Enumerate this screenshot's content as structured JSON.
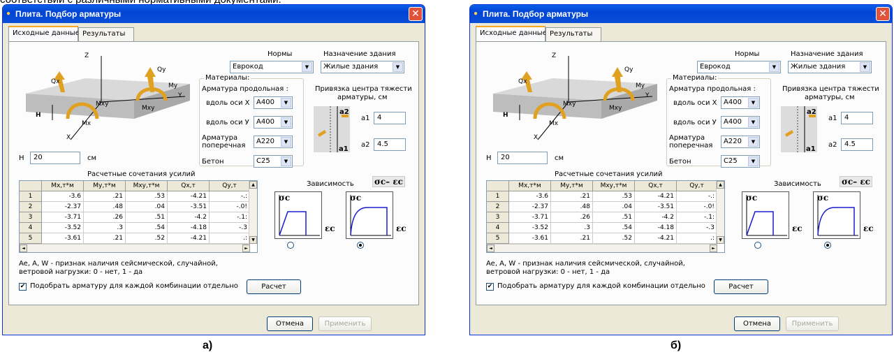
{
  "doc": {
    "top_text": "соответствии с различными нормативными документами."
  },
  "captions": {
    "left": "а)",
    "right": "б)"
  },
  "colors": {
    "titlebar": "#0a5ee8",
    "panel": "#ece9d8",
    "curve": "#1a1ad0",
    "arrows": "#e0a020"
  },
  "windows": [
    {
      "title": "Плита. Подбор арматуры",
      "tabs": [
        "Исходные данные",
        "Результаты"
      ],
      "norms": {
        "label": "Нормы",
        "value": "Еврокод"
      },
      "purpose": {
        "label": "Назначение здания",
        "value": "Жилые здания"
      },
      "materials": {
        "group_label": "Материалы:",
        "long_rebar_label": "Арматура  продольная :",
        "along_x_label": "вдоль оси X",
        "along_x_value": "A400",
        "along_y_label": "вдоль оси У",
        "along_y_value": "A400",
        "transverse_label_1": "Арматура",
        "transverse_label_2": "поперечная",
        "transverse_value": "A220",
        "concrete_label": "Бетон",
        "concrete_value": "C25"
      },
      "binding": {
        "title_1": "Привязка центра тяжести",
        "title_2": "арматуры, см",
        "a1_label": "a1",
        "a1_value": "4",
        "a2_label": "a2",
        "a2_value": "4.5",
        "pic_a2": "a2",
        "pic_a1": "a1"
      },
      "slab_labels": {
        "z": "Z",
        "y": "Y",
        "x": "X",
        "qx": "Qx",
        "qy": "Qy",
        "my": "My",
        "mxy_a": "Mxy",
        "mxy_b": "Mxy",
        "mx": "Mx",
        "h": "H"
      },
      "h_field": {
        "label": "H",
        "value": "20",
        "unit": "см"
      },
      "grid": {
        "title": "Расчетные сочетания усилий",
        "columns": [
          "Mx,т*м",
          "My,т*м",
          "Mxy,т*м",
          "Qx,т",
          "Qy,т"
        ],
        "rows": [
          {
            "n": "1",
            "cells": [
              "-3.6",
              ".21",
              ".53",
              "-4.21",
              "-.:"
            ]
          },
          {
            "n": "2",
            "cells": [
              "-2.37",
              ".48",
              ".04",
              "-3.51",
              "-.0!"
            ]
          },
          {
            "n": "3",
            "cells": [
              "-3.71",
              ".26",
              ".51",
              "-4.2",
              "-.1:"
            ]
          },
          {
            "n": "4",
            "cells": [
              "-3.52",
              ".3",
              ".54",
              "-4.18",
              "-.3"
            ]
          },
          {
            "n": "5",
            "cells": [
              "-3.61",
              ".21",
              ".52",
              "-4.21",
              ".:"
            ]
          }
        ]
      },
      "dependency": {
        "label": "Зависимость",
        "formula": "σc– εc",
        "sigma": "σc",
        "eps": "εc"
      },
      "note_1": "Ae, A, W  -  признак наличия сейсмической, случайной,",
      "note_2": "ветровой нагрузки: 0 - нет, 1 - да",
      "checkbox_label": "Подобрать арматуру для каждой комбинации отдельно",
      "calc_button": "Расчет",
      "cancel_button": "Отмена",
      "apply_button": "Применить"
    },
    {
      "title": "Плита. Подбор арматуры",
      "tabs": [
        "Исходные данные",
        "Результаты"
      ],
      "norms": {
        "label": "Нормы",
        "value": "Еврокод"
      },
      "purpose": {
        "label": "Назначение здания",
        "value": "Жилые здания"
      },
      "materials": {
        "group_label": "Материалы:",
        "long_rebar_label": "Арматура  продольная :",
        "along_x_label": "вдоль оси X",
        "along_x_value": "A400",
        "along_y_label": "вдоль оси У",
        "along_y_value": "A400",
        "transverse_label_1": "Арматура",
        "transverse_label_2": "поперечная",
        "transverse_value": "A220",
        "concrete_label": "Бетон",
        "concrete_value": "C25"
      },
      "binding": {
        "title_1": "Привязка центра тяжести",
        "title_2": "арматуры, см",
        "a1_label": "a1",
        "a1_value": "4",
        "a2_label": "a2",
        "a2_value": "4.5",
        "pic_a2": "a2",
        "pic_a1": "a1"
      },
      "slab_labels": {
        "z": "Z",
        "y": "Y",
        "x": "X",
        "qx": "Qx",
        "qy": "Qy",
        "my": "My",
        "mxy_a": "Mxy",
        "mxy_b": "Mxy",
        "mx": "Mx",
        "h": "H"
      },
      "h_field": {
        "label": "H",
        "value": "20",
        "unit": "см"
      },
      "grid": {
        "title": "Расчетные сочетания усилий",
        "columns": [
          "Mx,т*м",
          "My,т*м",
          "Mxy,т*м",
          "Qx,т",
          "Qy,т"
        ],
        "rows": [
          {
            "n": "1",
            "cells": [
              "-3.6",
              ".21",
              ".53",
              "-4.21",
              "-.:"
            ]
          },
          {
            "n": "2",
            "cells": [
              "-2.37",
              ".48",
              ".04",
              "-3.51",
              "-.0!"
            ]
          },
          {
            "n": "3",
            "cells": [
              "-3.71",
              ".26",
              ".51",
              "-4.2",
              "-.1:"
            ]
          },
          {
            "n": "4",
            "cells": [
              "-3.52",
              ".3",
              ".54",
              "-4.18",
              "-.3"
            ]
          },
          {
            "n": "5",
            "cells": [
              "-3.61",
              ".21",
              ".52",
              "-4.21",
              ".:"
            ]
          }
        ]
      },
      "dependency": {
        "label": "Зависимость",
        "formula": "σc– εc",
        "sigma": "σc",
        "eps": "εc"
      },
      "note_1": "Ae, A, W  -  признак наличия сейсмической, случайной,",
      "note_2": "ветровой нагрузки: 0 - нет, 1 - да",
      "checkbox_label": "Подобрать арматуру для каждой комбинации отдельно",
      "calc_button": "Расчет",
      "cancel_button": "Отмена",
      "apply_button": "Применить"
    }
  ]
}
